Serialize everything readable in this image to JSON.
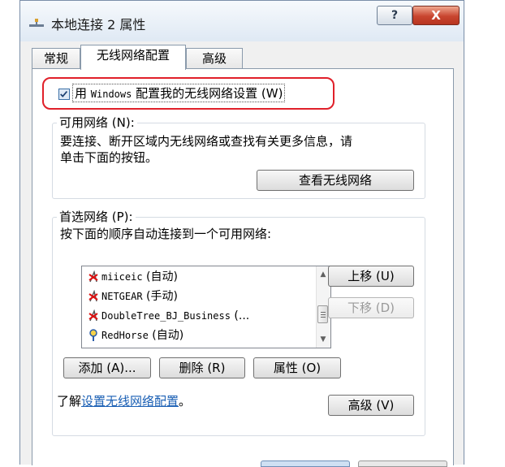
{
  "window": {
    "title": "本地连接 2 属性",
    "help_label": "?",
    "close_label": "X"
  },
  "tabs": [
    {
      "label": "常规",
      "active": false
    },
    {
      "label": "无线网络配置",
      "active": true
    },
    {
      "label": "高级",
      "active": false
    }
  ],
  "use_windows": {
    "checked": true,
    "label_prefix": "用 ",
    "label_windows": "Windows",
    "label_suffix": " 配置我的无线网络设置 (W)"
  },
  "available": {
    "group_label": "可用网络 (N):",
    "desc_line1": "要连接、断开区域内无线网络或查找有关更多信息，请",
    "desc_line2": "单击下面的按钮。",
    "view_button": "查看无线网络"
  },
  "preferred": {
    "group_label": "首选网络 (P):",
    "desc": "按下面的顺序自动连接到一个可用网络:",
    "networks": [
      {
        "name": "miiceic",
        "mode": "(自动)",
        "icon": "network-disconnected-icon"
      },
      {
        "name": "NETGEAR",
        "mode": "(手动)",
        "icon": "network-disconnected-icon"
      },
      {
        "name": "DoubleTree_BJ_Business",
        "mode": "(...",
        "icon": "network-disconnected-icon"
      },
      {
        "name": "RedHorse",
        "mode": "(自动)",
        "icon": "network-connected-icon"
      }
    ],
    "move_up": "上移 (U)",
    "move_down": "下移 (D)",
    "add": "添加 (A)...",
    "remove": "删除 (R)",
    "properties": "属性 (O)"
  },
  "learn": {
    "prefix": "了解",
    "link": "设置无线网络配置",
    "suffix": "。"
  },
  "advanced_button": "高级 (V)",
  "colors": {
    "highlight_border": "#e0202a",
    "link": "#1a5fb4",
    "close_button": "#c8452f"
  }
}
